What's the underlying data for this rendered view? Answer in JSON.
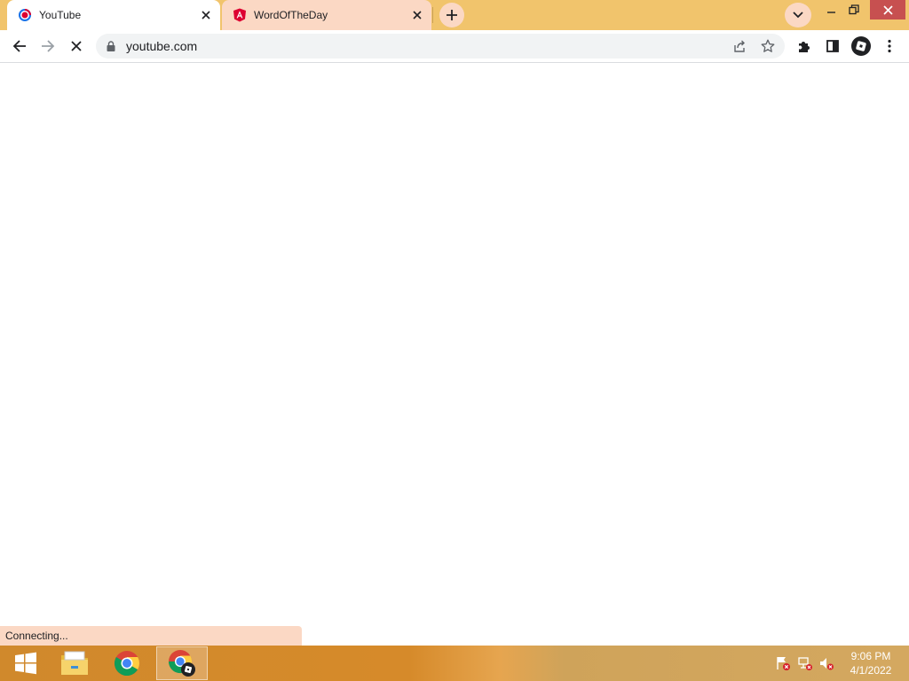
{
  "browser": {
    "tabs": [
      {
        "title": "YouTube",
        "icon": "youtube-loading-icon",
        "active": true
      },
      {
        "title": "WordOfTheDay",
        "icon": "angular-icon",
        "active": false
      }
    ],
    "address": "youtube.com",
    "status_text": "Connecting..."
  },
  "taskbar": {
    "time": "9:06 PM",
    "date": "4/1/2022",
    "items": [
      "start-button",
      "file-explorer",
      "chrome",
      "chrome-profile"
    ]
  },
  "colors": {
    "tabstrip": "#f1c46c",
    "inactive_tab": "#fbd8c4",
    "accent_red": "#dd0031"
  }
}
